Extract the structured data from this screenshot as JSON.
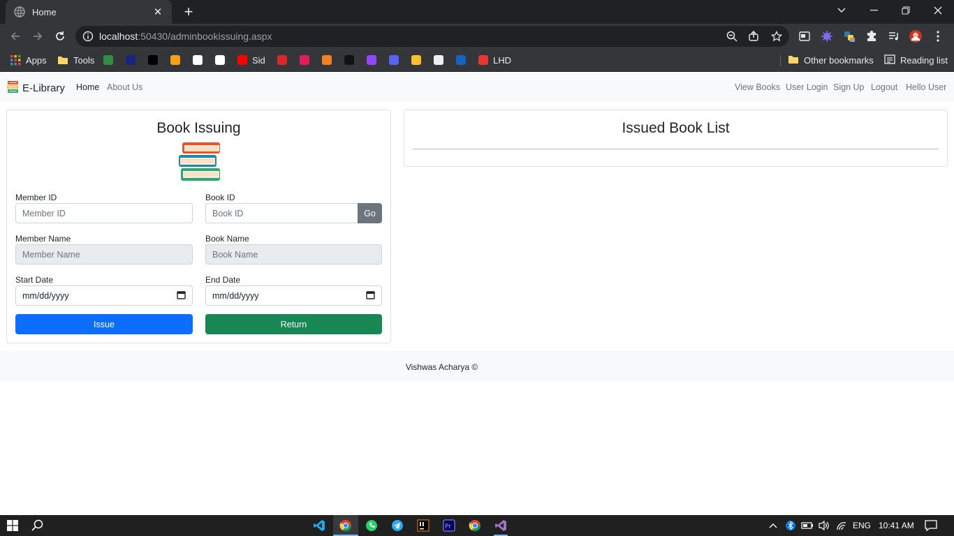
{
  "browser": {
    "tab_title": "Home",
    "tab_close": "✕",
    "new_tab": "+",
    "url_host": "localhost",
    "url_rest": ":50430/adminbookissuing.aspx",
    "bookmarks": [
      {
        "label": "Apps",
        "icon": "apps-grid-icon",
        "color": "#ea4335"
      },
      {
        "label": "Tools",
        "icon": "folder-icon",
        "color": "#fdd663"
      },
      {
        "label": "",
        "icon": "geeksforgeeks-icon",
        "color": "#2f8d46"
      },
      {
        "label": "",
        "icon": "bookmark-icon-blue",
        "color": "#1a237e"
      },
      {
        "label": "",
        "icon": "hackerrank-icon",
        "color": "#000000"
      },
      {
        "label": "",
        "icon": "bookmark-icon-orange",
        "color": "#f89f1b"
      },
      {
        "label": "",
        "icon": "bookmark-icon-hand",
        "color": "#ffffff"
      },
      {
        "label": "",
        "icon": "github-icon",
        "color": "#ffffff"
      },
      {
        "label": "Sid",
        "icon": "youtube-icon",
        "color": "#ff0000"
      },
      {
        "label": "",
        "icon": "mega-icon",
        "color": "#d9272e"
      },
      {
        "label": "",
        "icon": "slack-icon",
        "color": "#e01e5a"
      },
      {
        "label": "",
        "icon": "stackoverflow-icon",
        "color": "#f48024"
      },
      {
        "label": "",
        "icon": "bookmark-icon-dark",
        "color": "#111111"
      },
      {
        "label": "",
        "icon": "twitch-icon",
        "color": "#9146ff"
      },
      {
        "label": "",
        "icon": "discord-icon",
        "color": "#5865f2"
      },
      {
        "label": "",
        "icon": "bookmark-icon-yellow",
        "color": "#fbc02d"
      },
      {
        "label": "",
        "icon": "bookmark-icon-robot",
        "color": "#eeeeee"
      },
      {
        "label": "",
        "icon": "bookmark-icon-wave",
        "color": "#1565c0"
      },
      {
        "label": "LHD",
        "icon": "lhd-icon",
        "color": "#e53935"
      }
    ],
    "other_bookmarks": "Other bookmarks",
    "reading_list": "Reading list"
  },
  "navbar": {
    "brand": "E-Library",
    "home": "Home",
    "about": "About Us",
    "view_books": "View Books",
    "user_login": "User Login",
    "sign_up": "Sign Up",
    "logout": "Logout",
    "hello_user": "Hello User"
  },
  "issuing": {
    "title": "Book Issuing",
    "member_id_label": "Member ID",
    "member_id_placeholder": "Member ID",
    "book_id_label": "Book ID",
    "book_id_placeholder": "Book ID",
    "go_label": "Go",
    "member_name_label": "Member Name",
    "member_name_placeholder": "Member Name",
    "book_name_label": "Book Name",
    "book_name_placeholder": "Book Name",
    "start_date_label": "Start Date",
    "start_date_value": "mm/dd/yyyy",
    "end_date_label": "End Date",
    "end_date_value": "mm/dd/yyyy",
    "issue_label": "Issue",
    "return_label": "Return",
    "issue_color": "#0d6efd",
    "return_color": "#198754"
  },
  "issued_list": {
    "title": "Issued Book List"
  },
  "footer": {
    "text": "Vishwas Acharya ©"
  },
  "taskbar": {
    "language": "ENG",
    "time": "10:41 AM"
  }
}
